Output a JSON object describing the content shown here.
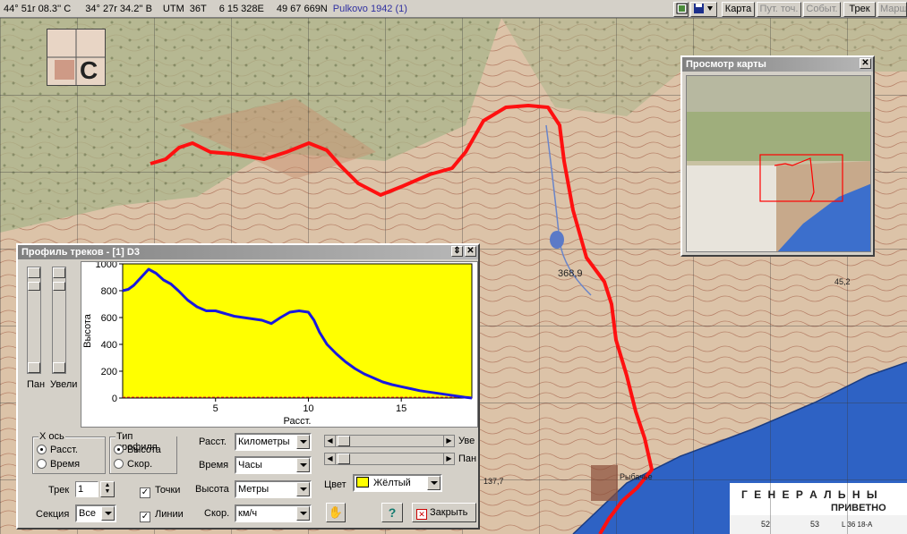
{
  "status": {
    "lat": "44° 51r 08.3'' С",
    "lon": "34° 27r 34.2'' В",
    "utm_label": "UTM",
    "zone": "36T",
    "easting": "6 15 328E",
    "northing": "49 67 669N",
    "datum": "Pulkovo 1942 (1)"
  },
  "toolbar": {
    "map": "Карта",
    "track_point": "Пут. точ.",
    "events": "Событ.",
    "track": "Трек",
    "route": "Марш"
  },
  "overview": {
    "title": "Просмотр карты"
  },
  "map_labels": {
    "peak": "368,9",
    "village": "Рыбачье",
    "elev1": "137,7",
    "elev2": "45,2",
    "sheet_title": "Г Е Н Е Р А Л Ь Н Ы",
    "sheet_sub": "ПРИВЕТНО",
    "grid1": "52",
    "grid2": "53",
    "sheet_code": "L 36 18-А"
  },
  "profile": {
    "title": "Профиль треков - [1] D3",
    "pan_label": "Пан",
    "zoom_label": "Увели",
    "x_axis": {
      "group_title": "X ось",
      "dist": "Расст.",
      "time": "Время",
      "selected": "dist"
    },
    "profile_type": {
      "group_title": "Тип профиля",
      "height": "Высота",
      "speed": "Скор.",
      "selected": "height"
    },
    "units": {
      "dist_label": "Расст.",
      "dist_value": "Километры",
      "time_label": "Время",
      "time_value": "Часы",
      "height_label": "Высота",
      "height_value": "Метры",
      "speed_label": "Скор.",
      "speed_value": "км/ч"
    },
    "slider_zoom_label": "Уве",
    "slider_pan_label": "Пан",
    "color_label": "Цвет",
    "color_value": "Жёлтый",
    "track_label": "Трек",
    "track_value": "1",
    "section_label": "Секция",
    "section_value": "Все",
    "points_label": "Точки",
    "lines_label": "Линии",
    "points_checked": true,
    "lines_checked": true,
    "help_label": "?",
    "close_label": "Закрыть"
  },
  "chart_data": {
    "type": "line",
    "xlabel": "Расст.",
    "ylabel": "Высота",
    "xlim": [
      0,
      18.8
    ],
    "ylim": [
      0,
      1000
    ],
    "x_ticks": [
      5,
      10,
      15
    ],
    "y_ticks": [
      0,
      200,
      400,
      600,
      800,
      1000
    ],
    "background": "#ffff00",
    "line_color": "#1818e0",
    "series": [
      {
        "x": [
          0,
          0.3,
          0.6,
          1.0,
          1.4,
          1.8,
          2.2,
          2.6,
          3.0,
          3.5,
          4.0,
          4.5,
          5.0,
          5.5,
          6.0,
          6.5,
          7.0,
          7.5,
          8.0,
          8.5,
          9.0,
          9.5,
          10.0,
          10.3,
          10.6,
          11.0,
          11.5,
          12.0,
          12.5,
          13.0,
          13.5,
          14.0,
          14.5,
          15.0,
          15.5,
          16.0,
          16.5,
          17.0,
          17.5,
          18.0,
          18.5,
          18.8
        ],
        "y": [
          800,
          810,
          840,
          900,
          960,
          930,
          880,
          850,
          800,
          730,
          680,
          650,
          650,
          630,
          610,
          600,
          590,
          580,
          555,
          600,
          640,
          650,
          640,
          580,
          490,
          400,
          330,
          270,
          220,
          180,
          150,
          120,
          100,
          85,
          70,
          55,
          45,
          35,
          25,
          15,
          5,
          0
        ]
      }
    ]
  }
}
